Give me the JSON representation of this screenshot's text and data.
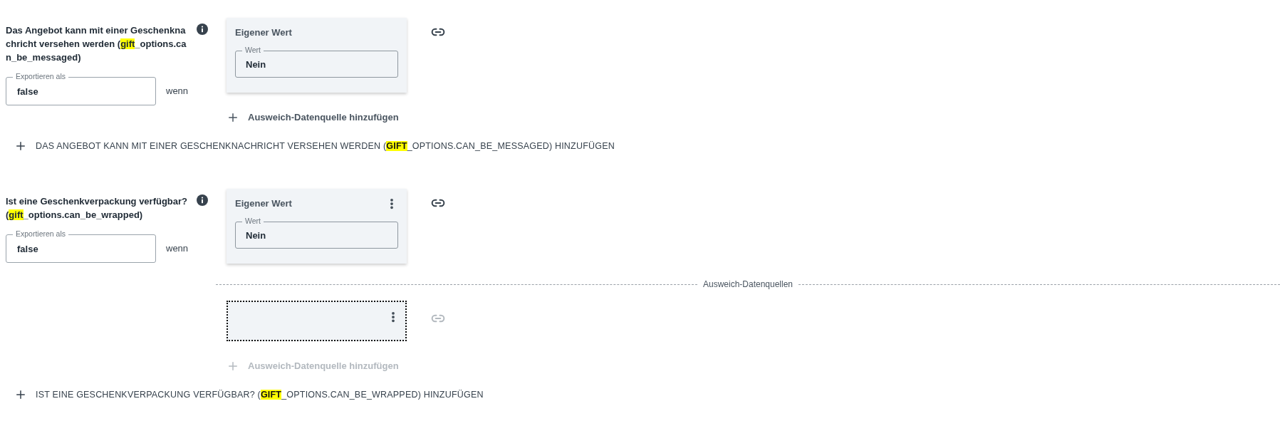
{
  "fields": [
    {
      "title": {
        "before": "Das Angebot kann mit einer Geschenknachricht versehen werden (",
        "highlight": "gift",
        "after": "_options.can_be_messaged)"
      },
      "export": {
        "label": "Exportieren als",
        "value": "false"
      },
      "condition": "wenn",
      "source": {
        "title": "Eigener Wert",
        "menu": false,
        "value_label": "Wert",
        "value": "Nein",
        "link_disabled": false
      },
      "add_fallback": {
        "label": "Ausweich-Datenquelle hinzufügen",
        "disabled": false
      },
      "add_field": {
        "before": "DAS ANGEBOT KANN MIT EINER GESCHENKNACHRICHT VERSEHEN WERDEN (",
        "highlight": "GIFT",
        "after": "_OPTIONS.CAN_BE_MESSAGED) HINZUFÜGEN"
      }
    },
    {
      "title": {
        "before": "Ist eine Geschenkverpackung verfügbar? (",
        "highlight": "gift",
        "after": "_options.can_be_wrapped)"
      },
      "export": {
        "label": "Exportieren als",
        "value": "false"
      },
      "condition": "wenn",
      "source": {
        "title": "Eigener Wert",
        "menu": true,
        "value_label": "Wert",
        "value": "Nein",
        "link_disabled": false
      },
      "fallbacks": {
        "heading": "Ausweich-Datenquellen",
        "items": [
          {
            "menu": true,
            "focused": true,
            "link_disabled": true
          }
        ]
      },
      "add_fallback": {
        "label": "Ausweich-Datenquelle hinzufügen",
        "disabled": true
      },
      "add_field": {
        "before": "IST EINE GESCHENKVERPACKUNG VERFÜGBAR? (",
        "highlight": "GIFT",
        "after": "_OPTIONS.CAN_BE_WRAPPED) HINZUFÜGEN"
      }
    }
  ]
}
